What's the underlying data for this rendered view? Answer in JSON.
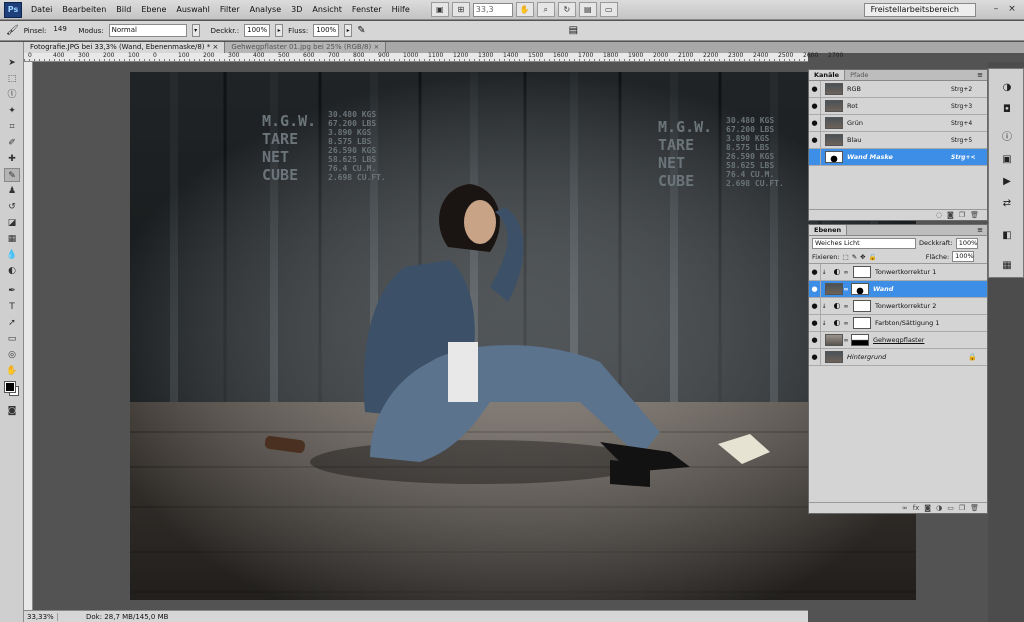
{
  "app": {
    "logo": "Ps"
  },
  "menu": [
    "Datei",
    "Bearbeiten",
    "Bild",
    "Ebene",
    "Auswahl",
    "Filter",
    "Analyse",
    "3D",
    "Ansicht",
    "Fenster",
    "Hilfe"
  ],
  "appbar": {
    "zoom": "33,3",
    "workspace": "Freistellarbeitsbereich"
  },
  "options": {
    "pinsel_label": "Pinsel:",
    "brush_size": "149",
    "modus_label": "Modus:",
    "modus_value": "Normal",
    "deckkr_label": "Deckkr.:",
    "deckkr_value": "100%",
    "fluss_label": "Fluss:",
    "fluss_value": "100%"
  },
  "tabs": [
    {
      "label": "Fotografie.JPG bei 33,3% (Wand, Ebenenmaske/8) *",
      "close": "×"
    },
    {
      "label": "Gehwegpflaster 01.jpg bei 25% (RGB/8)",
      "close": "×"
    }
  ],
  "ruler_labels": [
    "0",
    "400",
    "300",
    "200",
    "100",
    "0",
    "100",
    "200",
    "300",
    "400",
    "500",
    "600",
    "700",
    "800",
    "900",
    "1000",
    "1100",
    "1200",
    "1300",
    "1400",
    "1500",
    "1600",
    "1700",
    "1800",
    "1900",
    "2000",
    "2100",
    "2200",
    "2300",
    "2400",
    "2500",
    "2600",
    "2700"
  ],
  "photo_text": {
    "left_block": [
      "M.G.W.",
      "TARE",
      "NET",
      "CUBE"
    ],
    "left_values": [
      "30.480 KGS",
      "67.200 LBS",
      "3.890 KGS",
      "8.575 LBS",
      "26.590 KGS",
      "58.625 LBS",
      "76.4 CU.M.",
      "2.698 CU.FT."
    ],
    "right_block": [
      "M.G.W.",
      "TARE",
      "NET",
      "CUBE"
    ],
    "right_values": [
      "30.480 KGS",
      "67.200 LBS",
      "3.890 KGS",
      "8.575 LBS",
      "26.590 KGS",
      "58.625 LBS",
      "76.4 CU.M.",
      "2.698 CU.FT."
    ]
  },
  "status": {
    "zoom": "33,33%",
    "doc": "Dok: 28,7 MB/145,0 MB"
  },
  "channels_panel": {
    "tabs": [
      "Kanäle",
      "Pfade"
    ],
    "rows": [
      {
        "name": "RGB",
        "shortcut": "Strg+2"
      },
      {
        "name": "Rot",
        "shortcut": "Strg+3"
      },
      {
        "name": "Grün",
        "shortcut": "Strg+4"
      },
      {
        "name": "Blau",
        "shortcut": "Strg+5"
      },
      {
        "name": "Wand Maske",
        "shortcut": "Strg+<"
      }
    ]
  },
  "layers_panel": {
    "tab": "Ebenen",
    "blend_mode": "Weiches Licht",
    "deckkraft_label": "Deckkraft:",
    "deckkraft_value": "100%",
    "fixieren_label": "Fixieren:",
    "flaeche_label": "Fläche:",
    "flaeche_value": "100%",
    "layers": [
      {
        "name": "Tonwertkorrektur 1"
      },
      {
        "name": "Wand"
      },
      {
        "name": "Tonwertkorrektur 2"
      },
      {
        "name": "Farbton/Sättigung 1"
      },
      {
        "name": "Gehwegpflaster"
      },
      {
        "name": "Hintergrund"
      }
    ]
  }
}
